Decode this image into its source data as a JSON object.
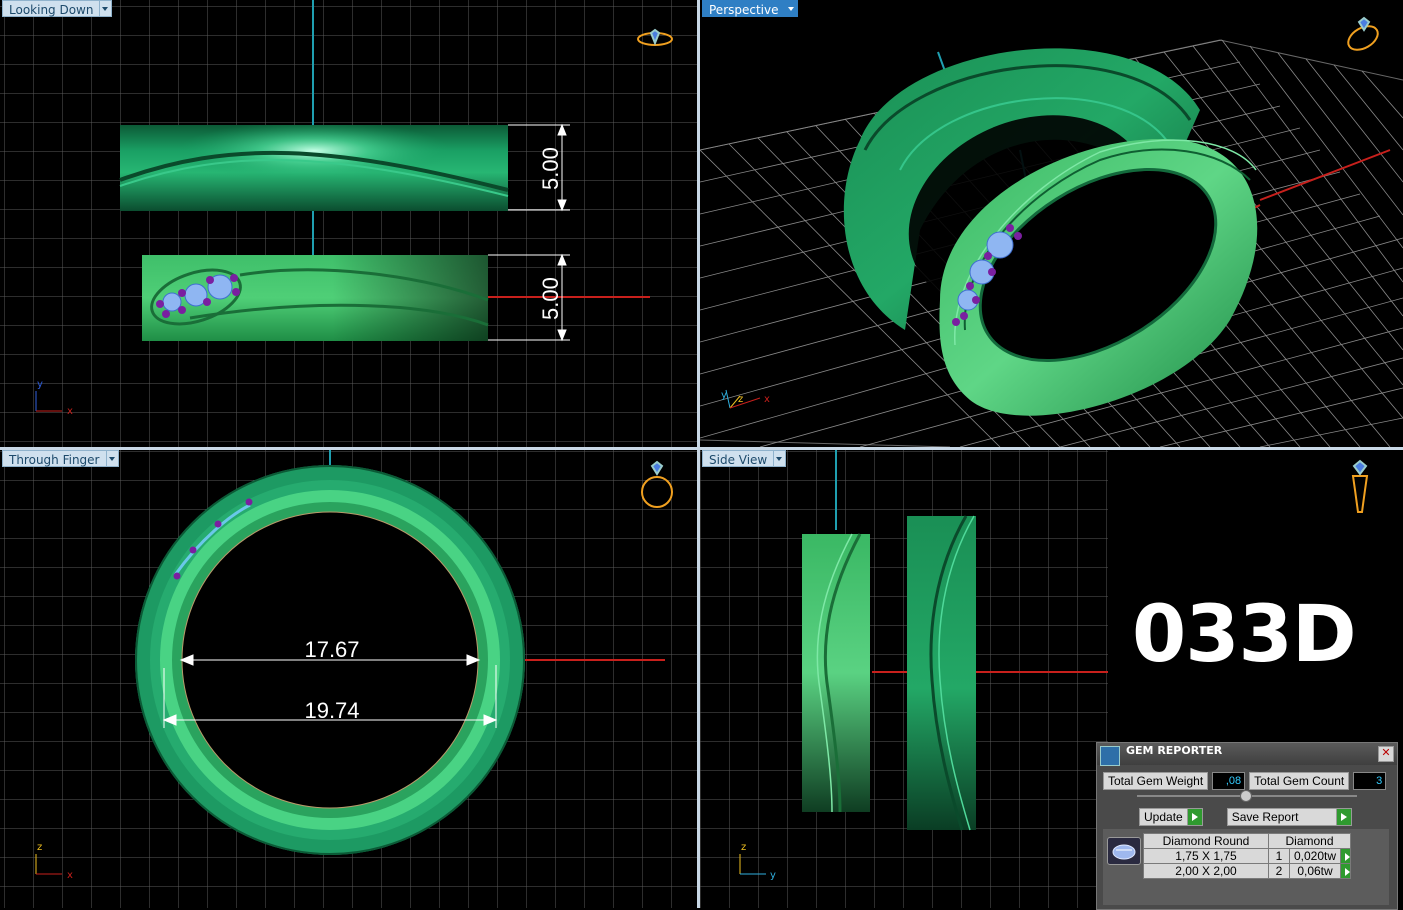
{
  "viewports": {
    "top_left": {
      "label": "Looking Down",
      "dimensions": [
        "5.00",
        "5.00"
      ],
      "axes": [
        "y",
        "x"
      ]
    },
    "top_right": {
      "label": "Perspective",
      "axes": [
        "y",
        "z",
        "x"
      ]
    },
    "bottom_left": {
      "label": "Through Finger",
      "dimensions": [
        "17.67",
        "19.74"
      ],
      "axes": [
        "z",
        "x"
      ]
    },
    "bottom_right": {
      "label": "Side View",
      "axes": [
        "z",
        "y"
      ]
    }
  },
  "model_code": "033D",
  "gem_reporter": {
    "title": "GEM REPORTER",
    "close_label": "✕",
    "total_weight_label": "Total Gem Weight",
    "total_weight_value": ",08",
    "total_count_label": "Total Gem Count",
    "total_count_value": "3",
    "update_label": "Update",
    "save_label": "Save Report",
    "header": {
      "cut": "Diamond Round",
      "material": "Diamond"
    },
    "rows": [
      {
        "size": "1,75 X 1,75",
        "count": "1",
        "weight": "0,020tw"
      },
      {
        "size": "2,00 X 2,00",
        "count": "2",
        "weight": "0,06tw"
      }
    ]
  },
  "icons": [
    "ring-top-icon",
    "ring-perspective-icon",
    "ring-front-icon",
    "ring-side-icon",
    "gem-reporter-logo-icon",
    "diamond-icon"
  ]
}
